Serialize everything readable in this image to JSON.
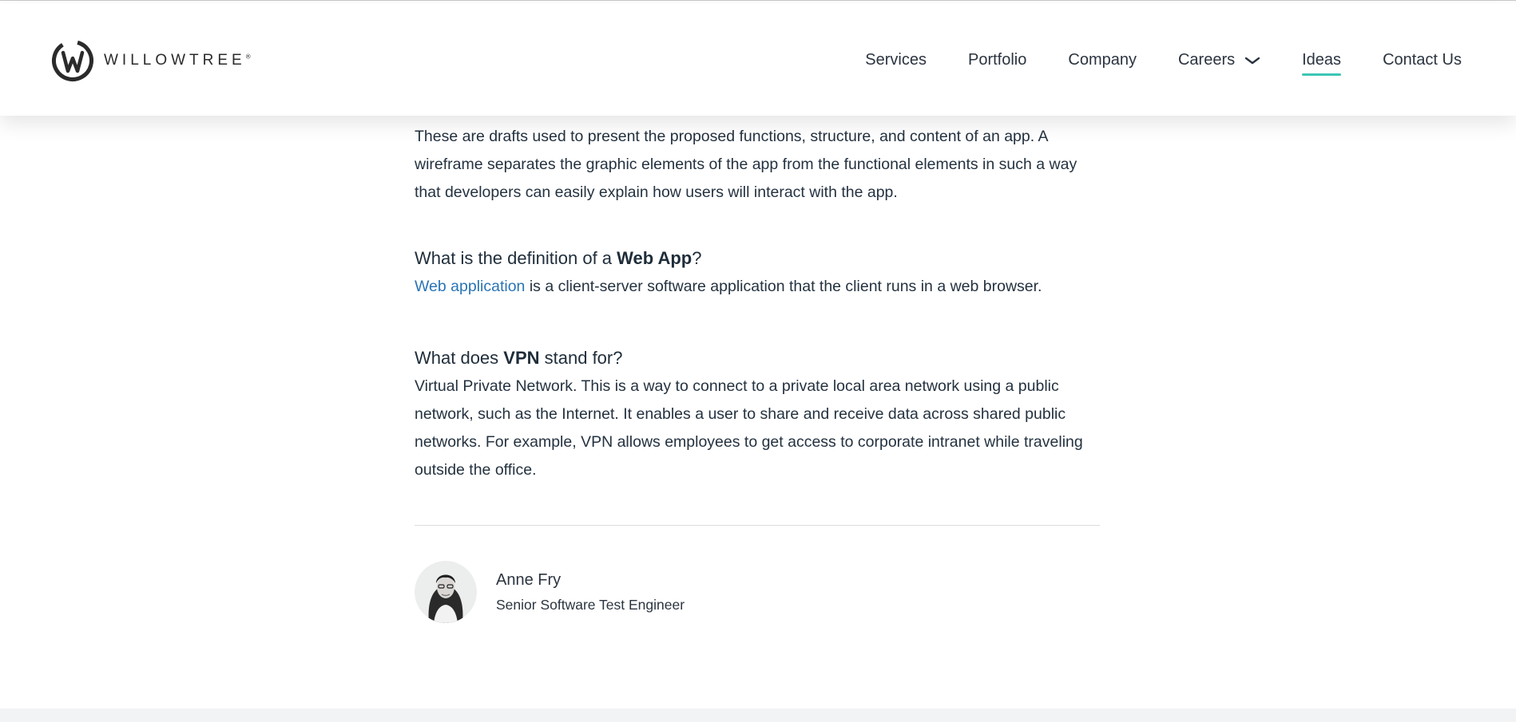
{
  "header": {
    "logo_text": "WILLOWTREE",
    "logo_mark": "®",
    "nav": [
      {
        "label": "Services"
      },
      {
        "label": "Portfolio"
      },
      {
        "label": "Company"
      },
      {
        "label": "Careers",
        "icon": "chevron-down-icon"
      },
      {
        "label": "Ideas",
        "active": true
      },
      {
        "label": "Contact Us"
      }
    ]
  },
  "article": {
    "intro": "These are drafts used to present the proposed functions, structure, and content of an app. A wireframe separates the graphic elements of the app from the functional elements in such a way that developers can easily explain how users will interact with the app.",
    "q1": {
      "prefix": "What is the definition of a ",
      "bold": "Web App",
      "suffix": "?"
    },
    "a1": {
      "link": "Web application",
      "text": " is a client-server software application that the client runs in a web browser."
    },
    "q2": {
      "prefix": "What does ",
      "bold": "VPN",
      "suffix": " stand for?"
    },
    "a2": "Virtual Private Network. This is a way to connect to a private local area network using a public network, such as the Internet. It enables a user to share and receive data across shared public networks. For example, VPN allows employees to get access to corporate intranet while traveling outside the office."
  },
  "author": {
    "name": "Anne Fry",
    "title": "Senior Software Test Engineer"
  },
  "colors": {
    "accent": "#3cc6b6",
    "link": "#2a74b5",
    "text": "#243240"
  }
}
